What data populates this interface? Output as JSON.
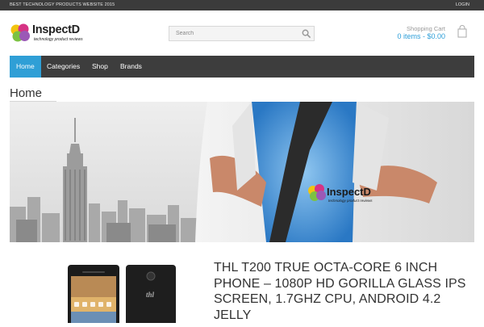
{
  "topbar": {
    "tagline": "BEST TECHNOLOGY PRODUCTS WEBSITE 2015",
    "login": "LOGIN"
  },
  "logo": {
    "brand": "InspectD",
    "subtitle": "technology product reviews"
  },
  "search": {
    "placeholder": "Search"
  },
  "cart": {
    "label": "Shopping Cart",
    "summary": "0 items - $0.00"
  },
  "nav": {
    "items": [
      {
        "label": "Home",
        "active": true
      },
      {
        "label": "Categories",
        "active": false
      },
      {
        "label": "Shop",
        "active": false
      },
      {
        "label": "Brands",
        "active": false
      }
    ]
  },
  "page": {
    "title": "Home"
  },
  "banner": {
    "brand": "InspectD",
    "subtitle": "technology product reviews"
  },
  "product": {
    "title": "THL T200 TRUE OCTA-CORE 6 INCH PHONE – 1080P HD GORILLA GLASS IPS SCREEN, 1.7GHZ CPU, ANDROID 4.2 JELLY",
    "phone_brand": "thl"
  },
  "colors": {
    "accent": "#2f9fd6",
    "topbar": "#3b3b3b",
    "nav": "#3d3d3d"
  }
}
